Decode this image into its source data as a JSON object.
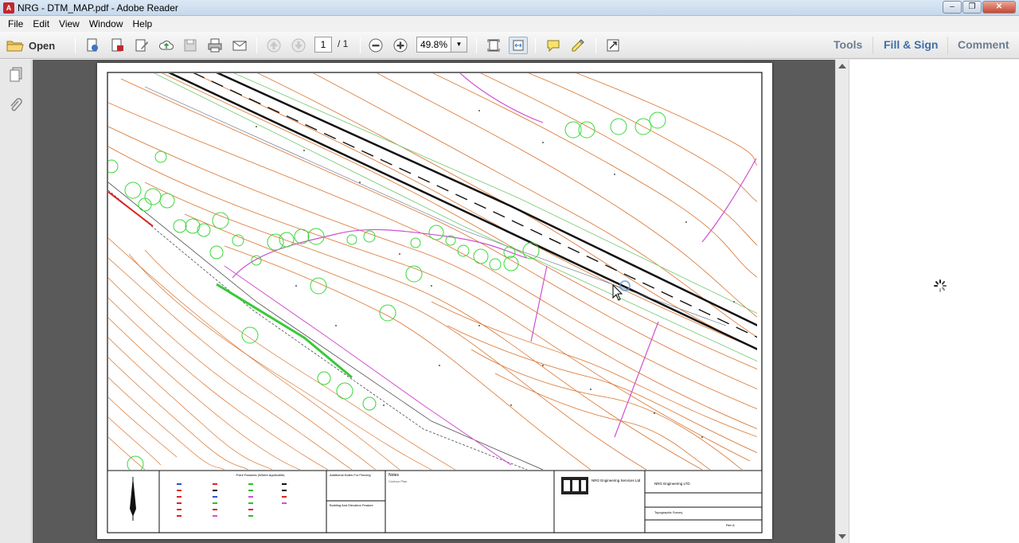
{
  "window": {
    "title": "NRG - DTM_MAP.pdf - Adobe Reader"
  },
  "menu": [
    "File",
    "Edit",
    "View",
    "Window",
    "Help"
  ],
  "toolbar": {
    "open_label": "Open",
    "page_current": "1",
    "page_total": "/ 1",
    "zoom": "49.8%"
  },
  "right_links": {
    "tools": "Tools",
    "fill_sign": "Fill & Sign",
    "comment": "Comment"
  },
  "titleblock": {
    "point_features_heading": "Point Features (Where Applicable)",
    "fencing_heading": "Additional Notes For Fencing",
    "building_heading": "Building And Elevation Feature",
    "notes_heading": "Notes",
    "notes_body": "Contour Plan",
    "company_name": "NRG Engineering Services Ltd",
    "client": "NRG Engineering LTD",
    "project_label": "Topographic Survey",
    "revision": "Rev A"
  }
}
